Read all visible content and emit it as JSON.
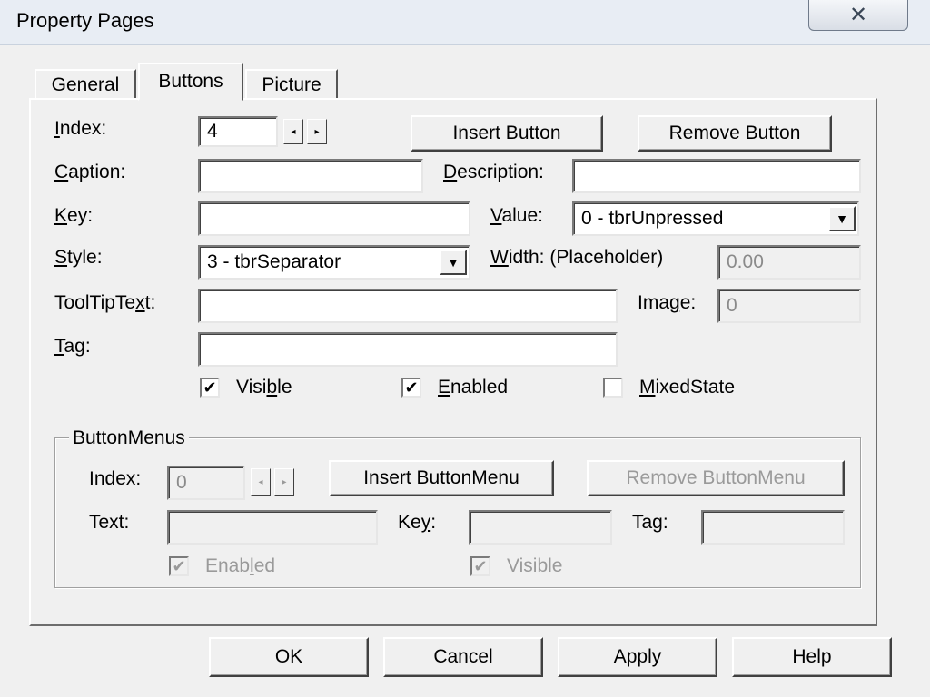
{
  "window": {
    "title": "Property Pages",
    "close_glyph": "✕"
  },
  "tabs": [
    {
      "label": "General"
    },
    {
      "label": "Buttons",
      "selected": true
    },
    {
      "label": "Picture"
    }
  ],
  "fields": {
    "index": {
      "label": "Index:",
      "value": "4"
    },
    "caption": {
      "label": "Caption:",
      "value": ""
    },
    "description": {
      "label": "Description:",
      "value": ""
    },
    "key": {
      "label": "Key:",
      "value": ""
    },
    "value": {
      "label": "Value:",
      "selected": "0 - tbrUnpressed"
    },
    "style": {
      "label": "Style:",
      "selected": "3 - tbrSeparator"
    },
    "width": {
      "label": "Width: (Placeholder)",
      "value": "0.00"
    },
    "tooltiptext": {
      "label": "ToolTipText:",
      "value": ""
    },
    "image": {
      "label": "Image:",
      "value": "0"
    },
    "tag": {
      "label": "Tag:",
      "value": ""
    }
  },
  "buttons": {
    "insert": "Insert Button",
    "remove": "Remove Button"
  },
  "checkboxes": {
    "visible": {
      "label": "Visible",
      "checked": true
    },
    "enabled": {
      "label": "Enabled",
      "checked": true
    },
    "mixedstate": {
      "label": "MixedState",
      "checked": false
    }
  },
  "buttonmenus": {
    "title": "ButtonMenus",
    "index": {
      "label": "Index:",
      "value": "0"
    },
    "insert": "Insert ButtonMenu",
    "remove": "Remove ButtonMenu",
    "text": {
      "label": "Text:",
      "value": ""
    },
    "key": {
      "label": "Key:",
      "value": ""
    },
    "tag": {
      "label": "Tag:",
      "value": ""
    },
    "enabled": {
      "label": "Enabled",
      "checked": true
    },
    "visible": {
      "label": "Visible",
      "checked": true
    }
  },
  "footer": {
    "ok": "OK",
    "cancel": "Cancel",
    "apply": "Apply",
    "help": "Help"
  },
  "glyphs": {
    "check": "✔",
    "spin_left": "◂",
    "spin_right": "▸",
    "drop_arrow": "▼"
  }
}
